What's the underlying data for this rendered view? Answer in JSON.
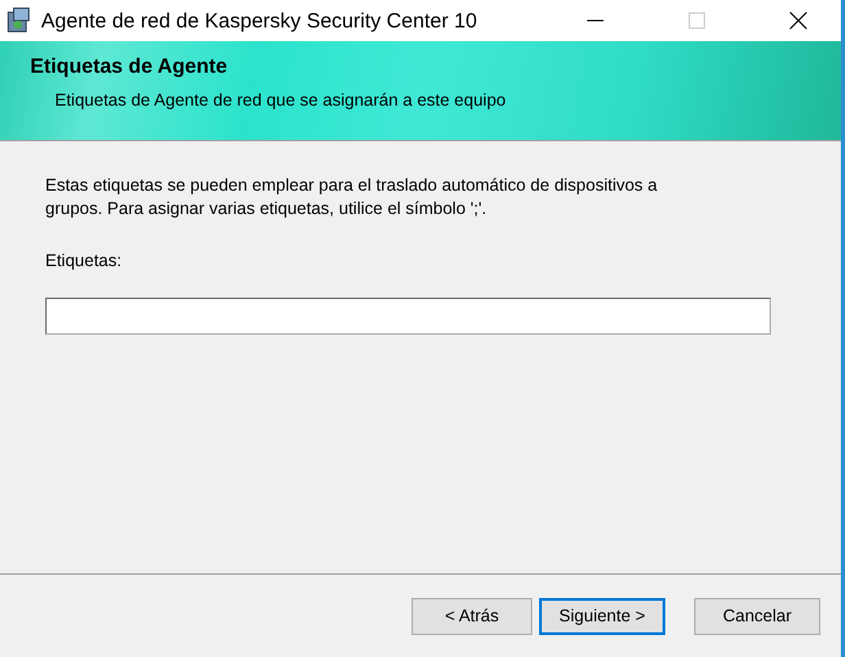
{
  "window": {
    "title": "Agente de red de Kaspersky Security Center 10"
  },
  "header": {
    "title": "Etiquetas de Agente",
    "subtitle": "Etiquetas de Agente de red que se asignarán a este equipo"
  },
  "description": "Estas etiquetas se pueden emplear para el traslado automático de dispositivos a grupos. Para asignar varias etiquetas, utilice el símbolo ';'.",
  "tags_field": {
    "label": "Etiquetas:"
  },
  "buttons": [
    {
      "label": "< Atrás",
      "default": false
    },
    {
      "label": "Siguiente >",
      "default": true
    },
    {
      "label": "Cancelar",
      "default": false
    }
  ]
}
